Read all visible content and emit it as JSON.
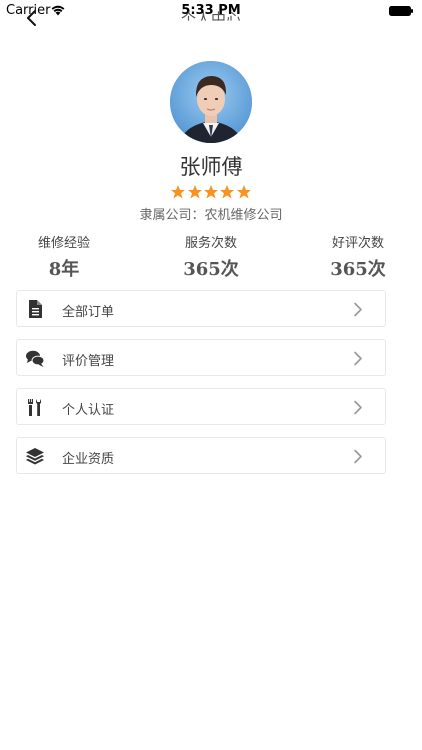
{
  "status_bar": {
    "carrier": "Carrier",
    "time": "5:33 PM"
  },
  "nav": {
    "title": "个人中心"
  },
  "profile": {
    "name": "张师傅",
    "rating_stars": 5,
    "company_label": "隶属公司：",
    "company_name": "农机维修公司"
  },
  "stats": [
    {
      "label": "维修经验",
      "value": "8年"
    },
    {
      "label": "服务次数",
      "value": "365次"
    },
    {
      "label": "好评次数",
      "value": "365次"
    }
  ],
  "menu": [
    {
      "label": "全部订单",
      "icon": "document-icon"
    },
    {
      "label": "评价管理",
      "icon": "comments-icon"
    },
    {
      "label": "个人认证",
      "icon": "tools-icon"
    },
    {
      "label": "企业资质",
      "icon": "layers-icon"
    }
  ],
  "colors": {
    "star": "#f7931e",
    "icon": "#333333",
    "chevron": "#999999"
  }
}
